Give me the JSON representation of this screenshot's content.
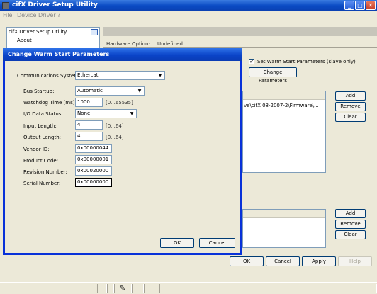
{
  "window": {
    "title": "cifX Driver Setup Utility",
    "min_glyph": "_",
    "max_glyph": "□",
    "close_glyph": "✕"
  },
  "menu": [
    "File",
    "Device",
    "Driver",
    "?"
  ],
  "tree": {
    "root": "cifX Driver Setup Utility",
    "child": "About"
  },
  "hardware": {
    "label": "Hardware Option:",
    "value": "Undefined"
  },
  "right_panel": {
    "set_warm_start_label": "Set Warm Start Parameters (slave only)",
    "set_warm_start_checked": true,
    "change_parameters_label": "Change Parameters",
    "firmware_path": "ve\\cifX 08-2007-2\\Firmware\\...",
    "add_label": "Add",
    "remove_label": "Remove",
    "clear_label": "Clear",
    "add2_label": "Add",
    "remove2_label": "Remove",
    "clear2_label": "Clear"
  },
  "footer_buttons": {
    "ok": "OK",
    "cancel": "Cancel",
    "apply": "Apply",
    "help": "Help"
  },
  "dialog": {
    "title": "Change Warm Start Parameters",
    "communication_system_label": "Communications System:",
    "communication_system_value": "Ethercat",
    "bus_startup_label": "Bus Startup:",
    "bus_startup_value": "Automatic",
    "watchdog_label": "Watchdog Time [ms]:",
    "watchdog_value": "1000",
    "watchdog_range": "[0...65535]",
    "io_status_label": "I/O Data Status:",
    "io_status_value": "None",
    "input_length_label": "Input Length:",
    "input_length_value": "4",
    "input_length_range": "[0...64]",
    "output_length_label": "Output Length:",
    "output_length_value": "4",
    "output_length_range": "[0...64]",
    "vendor_id_label": "Vendor ID:",
    "vendor_id_value": "0x00000044",
    "product_code_label": "Product Code:",
    "product_code_value": "0x00000001",
    "revision_label": "Revision Number:",
    "revision_value": "0x00020000",
    "serial_label": "Serial Number:",
    "serial_value": "0x00000000",
    "ok_label": "OK",
    "cancel_label": "Cancel"
  },
  "icons": {
    "combo_arrow": "▼",
    "pen": "pen-icon"
  }
}
